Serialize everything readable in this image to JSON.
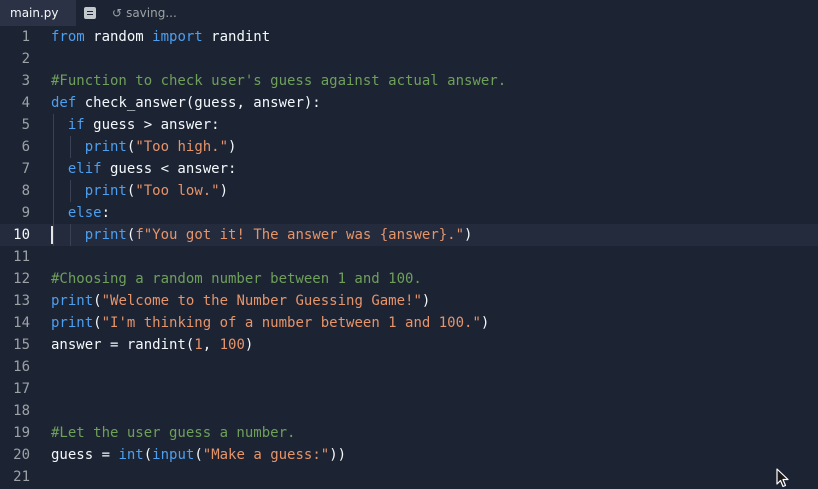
{
  "tabbar": {
    "tab_label": "main.py",
    "status_text": "saving..."
  },
  "editor": {
    "active_line": 10,
    "lines": [
      {
        "n": "1",
        "indent": 0,
        "tokens": [
          {
            "t": "from",
            "c": "kw"
          },
          {
            "t": " random ",
            "c": ""
          },
          {
            "t": "import",
            "c": "kw"
          },
          {
            "t": " randint",
            "c": ""
          }
        ]
      },
      {
        "n": "2",
        "indent": 0,
        "tokens": []
      },
      {
        "n": "3",
        "indent": 0,
        "tokens": [
          {
            "t": "#Function to check user's guess against actual answer.",
            "c": "cm"
          }
        ]
      },
      {
        "n": "4",
        "indent": 0,
        "tokens": [
          {
            "t": "def",
            "c": "kw"
          },
          {
            "t": " check_answer(guess, answer):",
            "c": ""
          }
        ]
      },
      {
        "n": "5",
        "indent": 1,
        "tokens": [
          {
            "t": "if",
            "c": "kw"
          },
          {
            "t": " guess > answer:",
            "c": ""
          }
        ]
      },
      {
        "n": "6",
        "indent": 2,
        "tokens": [
          {
            "t": "print",
            "c": "fn"
          },
          {
            "t": "(",
            "c": ""
          },
          {
            "t": "\"Too high.\"",
            "c": "str"
          },
          {
            "t": ")",
            "c": ""
          }
        ]
      },
      {
        "n": "7",
        "indent": 1,
        "tokens": [
          {
            "t": "elif",
            "c": "kw"
          },
          {
            "t": " guess < answer:",
            "c": ""
          }
        ]
      },
      {
        "n": "8",
        "indent": 2,
        "tokens": [
          {
            "t": "print",
            "c": "fn"
          },
          {
            "t": "(",
            "c": ""
          },
          {
            "t": "\"Too low.\"",
            "c": "str"
          },
          {
            "t": ")",
            "c": ""
          }
        ]
      },
      {
        "n": "9",
        "indent": 1,
        "tokens": [
          {
            "t": "else",
            "c": "kw"
          },
          {
            "t": ":",
            "c": ""
          }
        ]
      },
      {
        "n": "10",
        "indent": 2,
        "tokens": [
          {
            "t": "print",
            "c": "fn"
          },
          {
            "t": "(",
            "c": ""
          },
          {
            "t": "f\"You got it! The answer was {answer}.\"",
            "c": "str"
          },
          {
            "t": ")",
            "c": ""
          }
        ]
      },
      {
        "n": "11",
        "indent": 0,
        "tokens": []
      },
      {
        "n": "12",
        "indent": 0,
        "tokens": [
          {
            "t": "#Choosing a random number between 1 and 100.",
            "c": "cm"
          }
        ]
      },
      {
        "n": "13",
        "indent": 0,
        "tokens": [
          {
            "t": "print",
            "c": "fn"
          },
          {
            "t": "(",
            "c": ""
          },
          {
            "t": "\"Welcome to the Number Guessing Game!\"",
            "c": "str"
          },
          {
            "t": ")",
            "c": ""
          }
        ]
      },
      {
        "n": "14",
        "indent": 0,
        "tokens": [
          {
            "t": "print",
            "c": "fn"
          },
          {
            "t": "(",
            "c": ""
          },
          {
            "t": "\"I'm thinking of a number between 1 and 100.\"",
            "c": "str"
          },
          {
            "t": ")",
            "c": ""
          }
        ]
      },
      {
        "n": "15",
        "indent": 0,
        "tokens": [
          {
            "t": "answer = randint(",
            "c": ""
          },
          {
            "t": "1",
            "c": "num"
          },
          {
            "t": ", ",
            "c": ""
          },
          {
            "t": "100",
            "c": "num"
          },
          {
            "t": ")",
            "c": ""
          }
        ]
      },
      {
        "n": "16",
        "indent": 0,
        "tokens": []
      },
      {
        "n": "17",
        "indent": 0,
        "tokens": []
      },
      {
        "n": "18",
        "indent": 0,
        "tokens": []
      },
      {
        "n": "19",
        "indent": 0,
        "tokens": [
          {
            "t": "#Let the user guess a number.",
            "c": "cm"
          }
        ]
      },
      {
        "n": "20",
        "indent": 0,
        "tokens": [
          {
            "t": "guess = ",
            "c": ""
          },
          {
            "t": "int",
            "c": "fn"
          },
          {
            "t": "(",
            "c": ""
          },
          {
            "t": "input",
            "c": "fn"
          },
          {
            "t": "(",
            "c": ""
          },
          {
            "t": "\"Make a guess:\"",
            "c": "str"
          },
          {
            "t": "))",
            "c": ""
          }
        ]
      },
      {
        "n": "21",
        "indent": 0,
        "tokens": []
      }
    ]
  },
  "icons": {
    "file_outline": "document-icon",
    "status": "history-icon",
    "pointer": "mouse-cursor-icon"
  },
  "colors": {
    "background": "#1c2333",
    "keyword": "#4d9ff0",
    "string": "#e6946a",
    "comment": "#6ea05a"
  }
}
